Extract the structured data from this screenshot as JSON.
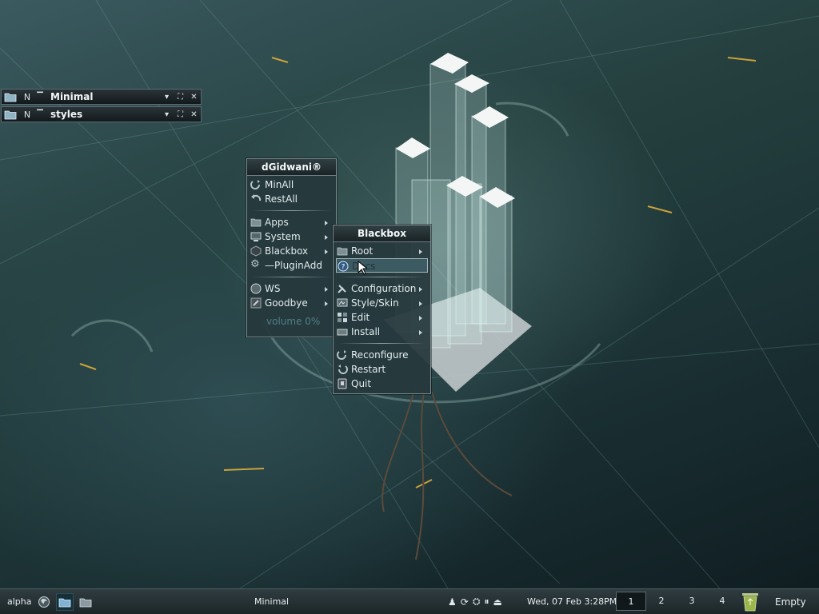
{
  "windows": [
    {
      "n": "N",
      "title": "Minimal"
    },
    {
      "n": "N",
      "title": "styles"
    }
  ],
  "root_menu": {
    "title": "dGidwani®",
    "group1": [
      {
        "label": "MinAll",
        "icon": "minimize-all-icon"
      },
      {
        "label": "RestAll",
        "icon": "restore-all-icon"
      }
    ],
    "group2": [
      {
        "label": "Apps",
        "icon": "folder-icon"
      },
      {
        "label": "System",
        "icon": "monitor-icon"
      },
      {
        "label": "Blackbox",
        "icon": "cube-icon"
      },
      {
        "label": "—PluginAdd",
        "icon": "gear-icon"
      }
    ],
    "group3": [
      {
        "label": "WS",
        "icon": "workspace-icon"
      },
      {
        "label": "Goodbye",
        "icon": "power-icon"
      }
    ],
    "volume": "volume 0%"
  },
  "blackbox_menu": {
    "title": "Blackbox",
    "group1": [
      {
        "label": "Root",
        "icon": "folder-icon"
      },
      {
        "label": "Docs",
        "icon": "help-icon"
      }
    ],
    "group2": [
      {
        "label": "Configuration",
        "icon": "wrench-icon"
      },
      {
        "label": "Style/Skin",
        "icon": "palette-icon"
      },
      {
        "label": "Edit",
        "icon": "edit-icon"
      },
      {
        "label": "Install",
        "icon": "install-icon"
      }
    ],
    "group3": [
      {
        "label": "Reconfigure",
        "icon": "reconfigure-icon"
      },
      {
        "label": "Restart",
        "icon": "restart-icon"
      },
      {
        "label": "Quit",
        "icon": "quit-icon"
      }
    ]
  },
  "taskbar": {
    "workspace": "alpha",
    "current_window": "Minimal",
    "clock": "Wed, 07 Feb 3:28PM",
    "workspaces": [
      "1",
      "2",
      "3",
      "4"
    ],
    "trash_label": "Empty"
  },
  "colors": {
    "menu_bg": "#26383c",
    "highlight": "#3c5a62",
    "volume_text": "#4f7f8a"
  }
}
